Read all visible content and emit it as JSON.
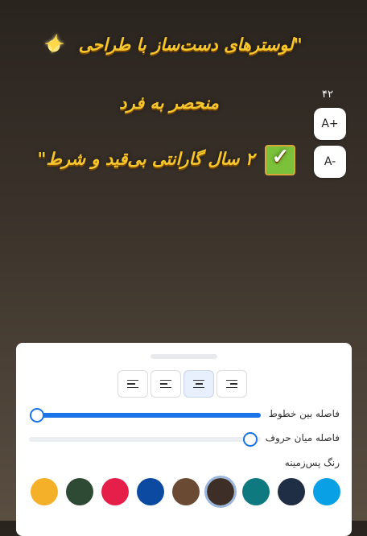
{
  "caption": {
    "line1": "\"لوسترهای دست‌ساز با طراحی",
    "line2": "منحصر به فرد",
    "line3": "۲ سال گارانتی بی‌قید و شرط\""
  },
  "font_controls": {
    "size_value": "۴۲",
    "increase_label": "A+",
    "decrease_label": "A-"
  },
  "panel": {
    "alignment_options": [
      "align-left",
      "align-center",
      "align-justify",
      "align-right"
    ],
    "selected_alignment": "align-center",
    "line_spacing": {
      "label": "فاصله بین خطوط",
      "value_fraction": 0.97
    },
    "letter_spacing": {
      "label": "فاصله میان حروف",
      "value_fraction": 0.05
    },
    "background_label": "رنگ پس‌زمینه",
    "background_colors": [
      "#0aa0e6",
      "#1f2d45",
      "#0e7a80",
      "#3d2f27",
      "#6a4a33",
      "#0b4aa0",
      "#e51f4a",
      "#2e4a35",
      "#f5b02a"
    ],
    "selected_background_index": 3
  }
}
